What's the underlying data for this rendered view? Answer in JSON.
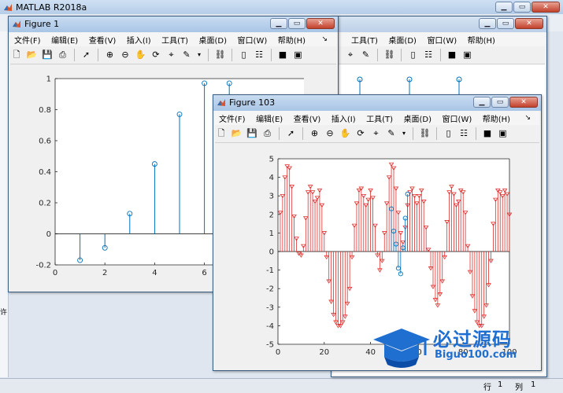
{
  "desktop": {
    "main_title": "MATLAB R2018a",
    "status_row_label": "行",
    "status_row_value": "1",
    "status_col_label": "列",
    "status_col_value": "1",
    "left_edge_letter": "许"
  },
  "menus": [
    "文件(F)",
    "编辑(E)",
    "查看(V)",
    "插入(I)",
    "工具(T)",
    "桌面(D)",
    "窗口(W)",
    "帮助(H)"
  ],
  "menu_arrow": "↘",
  "window_buttons": {
    "minimize": "▁",
    "restore": "▭",
    "close": "✕"
  },
  "figure1": {
    "title": "Figure 1"
  },
  "figure103": {
    "title": "Figure 103"
  },
  "behind_menus": [
    "工具(T)",
    "桌面(D)",
    "窗口(W)",
    "帮助(H)"
  ],
  "watermark": {
    "main": "必过源码",
    "sub": "Biguo100.com"
  },
  "colors": {
    "stem_blue": "#0072bd",
    "stem_red": "#e03030",
    "titlebar_active": "#a9c5e6"
  },
  "chart_data": [
    {
      "id": "figure1_axes",
      "type": "scatter",
      "style": "stem",
      "x": [
        1,
        2,
        3,
        4,
        5,
        6,
        7
      ],
      "values": [
        -0.17,
        -0.09,
        0.13,
        0.45,
        0.77,
        0.97,
        0.97
      ],
      "xlim": [
        0,
        10
      ],
      "ylim": [
        -0.2,
        1
      ],
      "xticks": [
        "0",
        "2",
        "4",
        "6"
      ],
      "yticks": [
        "-0.2",
        "0",
        "0.2",
        "0.4",
        "0.6",
        "0.8",
        "1"
      ],
      "marker": "circle",
      "color": "#0072bd"
    },
    {
      "id": "figure103_axes",
      "type": "scatter",
      "style": "stem",
      "xlim": [
        0,
        100
      ],
      "ylim": [
        -5,
        5
      ],
      "xticks": [
        "0",
        "20",
        "40",
        "60",
        "80",
        "100"
      ],
      "yticks": [
        "5",
        "4",
        "3",
        "2",
        "1",
        "0",
        "-1",
        "-2",
        "-3",
        "-4",
        "-5"
      ],
      "series": [
        {
          "marker": "triangle-down",
          "color": "#e03030",
          "x": [
            1,
            2,
            3,
            4,
            5,
            6,
            7,
            8,
            9,
            10,
            11,
            12,
            13,
            14,
            15,
            16,
            17,
            18,
            19,
            20,
            21,
            22,
            23,
            24,
            25,
            26,
            27,
            28,
            29,
            30,
            31,
            32,
            33,
            34,
            35,
            36,
            37,
            38,
            39,
            40,
            41,
            42,
            43,
            44,
            45,
            46,
            47,
            48,
            49,
            50,
            51,
            52,
            53,
            54,
            55,
            56,
            57,
            58,
            59,
            60,
            61,
            62,
            63,
            64,
            65,
            66,
            67,
            68,
            69,
            70,
            71,
            72,
            73,
            74,
            75,
            76,
            77,
            78,
            79,
            80,
            81,
            82,
            83,
            84,
            85,
            86,
            87,
            88,
            89,
            90,
            91,
            92,
            93,
            94,
            95,
            96,
            97,
            98,
            99,
            100
          ],
          "values": [
            2.1,
            3.0,
            4.0,
            4.6,
            4.5,
            3.5,
            1.9,
            0.7,
            -0.1,
            -0.2,
            0.3,
            1.8,
            3.2,
            3.5,
            3.2,
            2.7,
            2.9,
            3.3,
            2.5,
            1.0,
            -0.3,
            -1.6,
            -2.7,
            -3.4,
            -3.8,
            -4.0,
            -4.0,
            -3.8,
            -3.5,
            -2.8,
            -2.0,
            -0.3,
            1.4,
            2.6,
            3.3,
            3.4,
            3.0,
            2.5,
            2.8,
            3.3,
            2.9,
            1.4,
            -0.2,
            -1.0,
            -0.5,
            1.0,
            2.6,
            4.0,
            4.7,
            4.5,
            3.4,
            2.1,
            1.0,
            0.5,
            1.3,
            2.5,
            3.2,
            3.4,
            3.0,
            2.6,
            3.0,
            3.3,
            2.7,
            1.3,
            0.1,
            -0.9,
            -1.9,
            -2.6,
            -2.9,
            -2.3,
            -1.6,
            -0.3,
            1.6,
            3.2,
            3.5,
            3.1,
            2.5,
            2.7,
            3.3,
            3.2,
            2.1,
            0.3,
            -1.1,
            -2.4,
            -3.2,
            -3.8,
            -4.0,
            -4.0,
            -3.5,
            -2.9,
            -1.8,
            -0.5,
            1.5,
            2.8,
            3.3,
            3.2,
            3.0,
            3.3,
            3.1,
            2.0
          ]
        },
        {
          "marker": "circle",
          "color": "#0072bd",
          "x": [
            49,
            50,
            51,
            52,
            53,
            54,
            55,
            56
          ],
          "values": [
            2.3,
            1.1,
            0.4,
            -0.9,
            -1.2,
            0.2,
            1.8,
            3.1
          ]
        }
      ]
    }
  ]
}
